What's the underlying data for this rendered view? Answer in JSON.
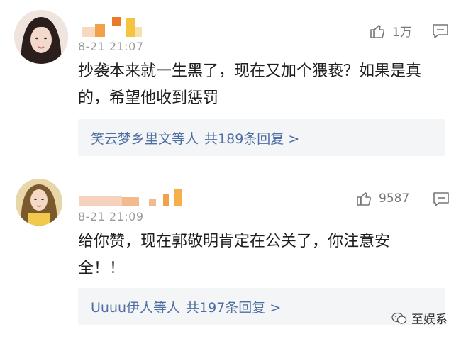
{
  "comments": [
    {
      "time": "8-21 21:07",
      "likes": "1万",
      "text_line1": "抄袭本来就一生黑了，现在又加个猥亵？如果是真",
      "text_line2": "的，希望他收到惩罚",
      "reply_names": "笑云梦乡里文等人",
      "reply_count": "共189条回复 >"
    },
    {
      "time": "8-21 21:09",
      "likes": "9587",
      "text_line1": "给你赞，现在郭敬明肯定在公关了，你注意安",
      "text_line2": "全！！",
      "reply_names": "Uuuu伊人等人",
      "reply_count": "共197条回复 >"
    }
  ],
  "watermark": {
    "text": "至娱系"
  },
  "colors": {
    "link": "#4f6ea3",
    "time": "#9a9a9a",
    "reply_bg": "#f4f5f7",
    "pixel_orange": "#f0a14a",
    "pixel_yellow": "#f5c542"
  },
  "icons": {
    "like": "thumbs-up-icon",
    "comment": "comment-bubble-icon",
    "watermark": "wechat-logo-icon"
  }
}
